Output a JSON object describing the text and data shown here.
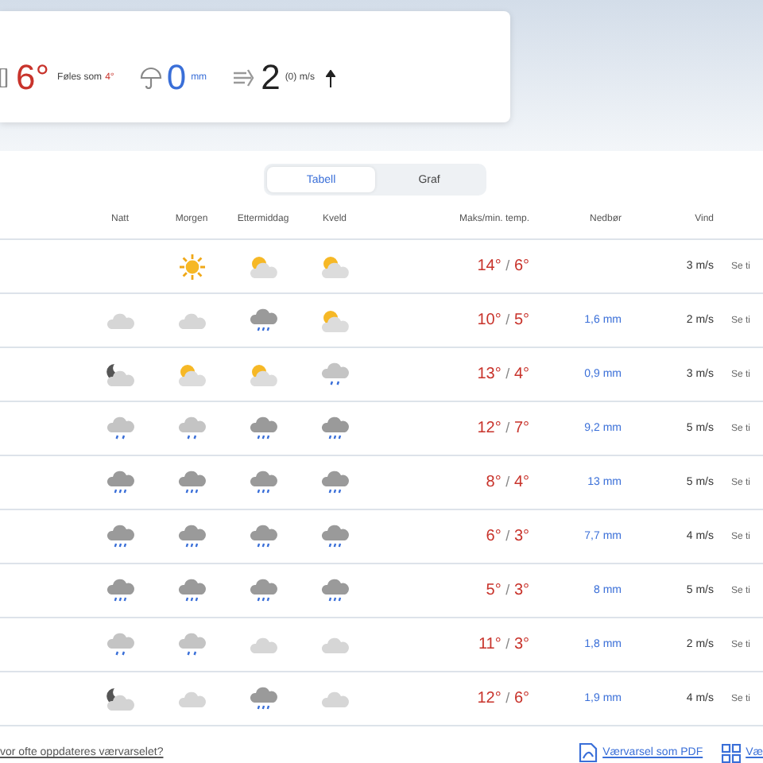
{
  "now": {
    "temperature": "6°",
    "feels_label": "Føles som",
    "feels_value": "4°",
    "precip_value": "0",
    "precip_unit": "mm",
    "wind_value": "2",
    "wind_unit": "(0) m/s"
  },
  "view_tabs": [
    {
      "label": "Tabell",
      "selected": true
    },
    {
      "label": "Graf",
      "selected": false
    }
  ],
  "table": {
    "columns": [
      "Natt",
      "Morgen",
      "Ettermiddag",
      "Kveld",
      "Maks/min. temp.",
      "Nedbør",
      "Vind"
    ],
    "rows": [
      {
        "icons": [
          {
            "kind": "none"
          },
          {
            "kind": "sun"
          },
          {
            "kind": "partsun"
          },
          {
            "kind": "partsun"
          }
        ],
        "max": "14°",
        "separator": "/",
        "min": "6°",
        "precip": "",
        "wind": "3 m/s",
        "link": "Se ti"
      },
      {
        "icons": [
          {
            "kind": "cloud"
          },
          {
            "kind": "cloud"
          },
          {
            "kind": "rain"
          },
          {
            "kind": "partsun"
          }
        ],
        "max": "10°",
        "separator": "/",
        "min": "5°",
        "precip": "1,6 mm",
        "wind": "2 m/s",
        "link": "Se ti"
      },
      {
        "icons": [
          {
            "kind": "moon"
          },
          {
            "kind": "partsun"
          },
          {
            "kind": "partsun"
          },
          {
            "kind": "lightrain"
          }
        ],
        "max": "13°",
        "separator": "/",
        "min": "4°",
        "precip": "0,9 mm",
        "wind": "3 m/s",
        "link": "Se ti"
      },
      {
        "icons": [
          {
            "kind": "lightrain"
          },
          {
            "kind": "lightrain"
          },
          {
            "kind": "rain"
          },
          {
            "kind": "rain"
          }
        ],
        "max": "12°",
        "separator": "/",
        "min": "7°",
        "precip": "9,2 mm",
        "wind": "5 m/s",
        "link": "Se ti"
      },
      {
        "icons": [
          {
            "kind": "rain"
          },
          {
            "kind": "rain"
          },
          {
            "kind": "rain"
          },
          {
            "kind": "rain"
          }
        ],
        "max": "8°",
        "separator": "/",
        "min": "4°",
        "precip": "13 mm",
        "wind": "5 m/s",
        "link": "Se ti"
      },
      {
        "icons": [
          {
            "kind": "rain"
          },
          {
            "kind": "rain"
          },
          {
            "kind": "rain"
          },
          {
            "kind": "rain"
          }
        ],
        "max": "6°",
        "separator": "/",
        "min": "3°",
        "precip": "7,7 mm",
        "wind": "4 m/s",
        "link": "Se ti"
      },
      {
        "icons": [
          {
            "kind": "rain"
          },
          {
            "kind": "rain"
          },
          {
            "kind": "rain"
          },
          {
            "kind": "rain"
          }
        ],
        "max": "5°",
        "separator": "/",
        "min": "3°",
        "precip": "8 mm",
        "wind": "5 m/s",
        "link": "Se ti"
      },
      {
        "icons": [
          {
            "kind": "lightrain"
          },
          {
            "kind": "lightrain"
          },
          {
            "kind": "cloud"
          },
          {
            "kind": "cloud"
          }
        ],
        "max": "11°",
        "separator": "/",
        "min": "3°",
        "precip": "1,8 mm",
        "wind": "2 m/s",
        "link": "Se ti"
      },
      {
        "icons": [
          {
            "kind": "moon"
          },
          {
            "kind": "cloud"
          },
          {
            "kind": "rain"
          },
          {
            "kind": "cloud"
          }
        ],
        "max": "12°",
        "separator": "/",
        "min": "6°",
        "precip": "1,9 mm",
        "wind": "4 m/s",
        "link": "Se ti"
      }
    ]
  },
  "footer": {
    "faq_link": "vor ofte oppdateres værvarselet?",
    "pdf_link": "Værvarsel som PDF",
    "other_link": "Væ"
  }
}
